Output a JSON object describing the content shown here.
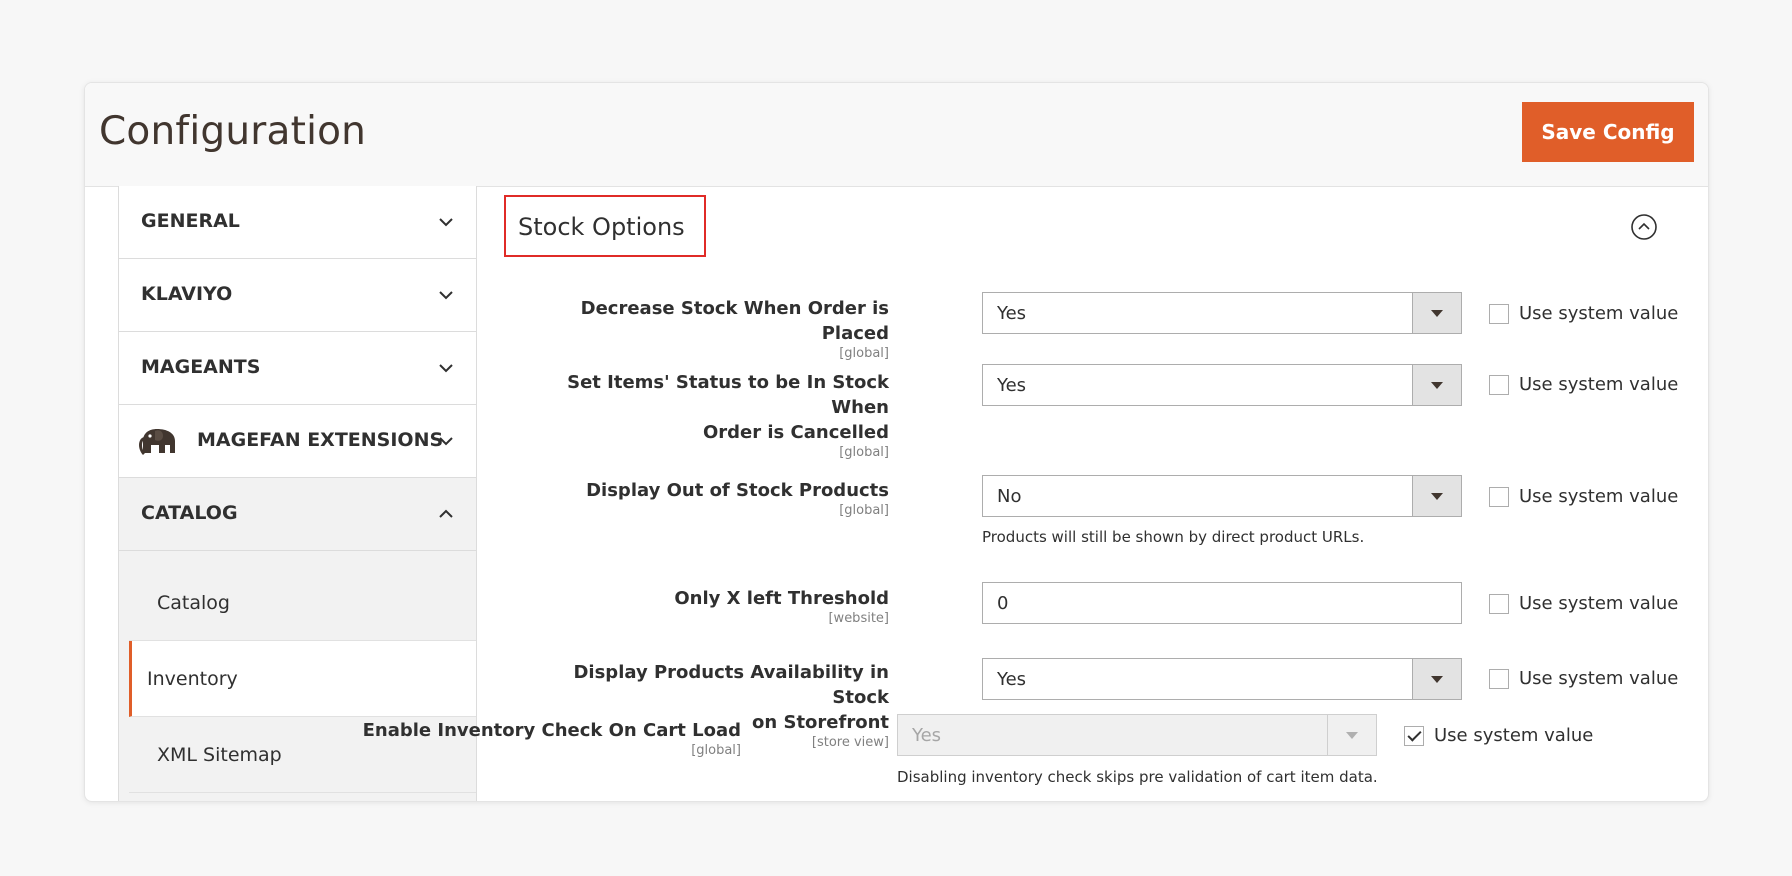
{
  "header": {
    "title": "Configuration",
    "save_label": "Save Config"
  },
  "sidebar": {
    "groups": [
      {
        "label": "GENERAL",
        "icon": "chevron-down-icon"
      },
      {
        "label": "KLAVIYO",
        "icon": "chevron-down-icon"
      },
      {
        "label": "MAGEANTS",
        "icon": "chevron-down-icon"
      },
      {
        "label": "MAGEFAN EXTENSIONS",
        "icon": "chevron-down-icon",
        "logo": "elephant-logo-icon"
      },
      {
        "label": "CATALOG",
        "icon": "chevron-up-icon"
      }
    ],
    "catalog_items": [
      {
        "label": "Catalog"
      },
      {
        "label": "Inventory",
        "active": true
      },
      {
        "label": "XML Sitemap"
      }
    ]
  },
  "section": {
    "title": "Stock Options",
    "collapse_icon": "collapse-up-icon"
  },
  "fields": [
    {
      "label": "Decrease Stock When Order is Placed",
      "scope": "[global]",
      "value": "Yes",
      "use_system": false
    },
    {
      "label_line1": "Set Items' Status to be In Stock When",
      "label_line2": "Order is Cancelled",
      "scope": "[global]",
      "value": "Yes",
      "use_system": false
    },
    {
      "label": "Display Out of Stock Products",
      "scope": "[global]",
      "value": "No",
      "use_system": false,
      "note": "Products will still be shown by direct product URLs."
    },
    {
      "label": "Only X left Threshold",
      "scope": "[website]",
      "value": "0",
      "use_system": false
    },
    {
      "label_line1": "Display Products Availability in Stock",
      "label_line2": "on Storefront",
      "scope": "[store view]",
      "value": "Yes",
      "use_system": false
    },
    {
      "label": "Enable Inventory Check On Cart Load",
      "scope": "[global]",
      "value": "Yes",
      "use_system": true,
      "disabled": true,
      "note": "Disabling inventory check skips pre validation of cart item data."
    }
  ],
  "use_system_label": "Use system value",
  "colors": {
    "accent": "#e05e29",
    "highlight_border": "#e02b27",
    "title": "#41362f"
  }
}
